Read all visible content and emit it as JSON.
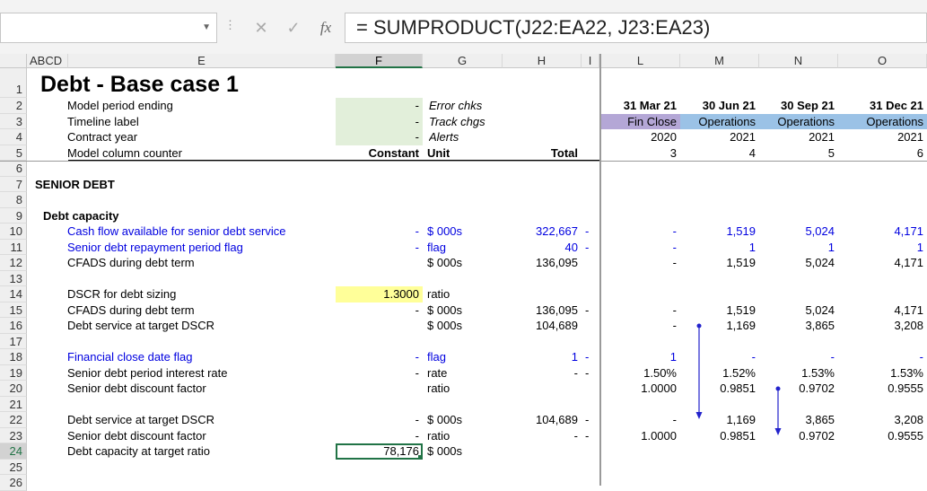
{
  "formula_bar": {
    "formula": "= SUMPRODUCT(J22:EA22, J23:EA23)",
    "cancel_icon": "✕",
    "enter_icon": "✓",
    "fx_label": "fx"
  },
  "columns": [
    "ABCD",
    "E",
    "F",
    "G",
    "H",
    "I",
    "L",
    "M",
    "N",
    "O"
  ],
  "row_numbers": [
    "1",
    "2",
    "3",
    "4",
    "5",
    "6",
    "7",
    "8",
    "9",
    "10",
    "11",
    "12",
    "13",
    "14",
    "15",
    "16",
    "17",
    "18",
    "19",
    "20",
    "21",
    "22",
    "23",
    "24",
    "25",
    "26"
  ],
  "sheet": {
    "title": "Debt - Base case 1",
    "header_rows": [
      {
        "label": "Model period ending",
        "f": "-",
        "g": "Error chks",
        "l": "31 Mar 21",
        "m": "30 Jun 21",
        "n": "30 Sep 21",
        "o": "31 Dec 21"
      },
      {
        "label": "Timeline label",
        "f": "-",
        "g": "Track chgs",
        "l": "Fin Close",
        "m": "Operations",
        "n": "Operations",
        "o": "Operations"
      },
      {
        "label": "Contract year",
        "f": "-",
        "g": "Alerts",
        "l": "2020",
        "m": "2021",
        "n": "2021",
        "o": "2021"
      },
      {
        "label": "Model column counter",
        "f": "Constant",
        "g": "Unit",
        "h": "Total",
        "l": "3",
        "m": "4",
        "n": "5",
        "o": "6"
      }
    ],
    "section": "SENIOR DEBT",
    "subsection": "Debt capacity",
    "rows": {
      "r10": {
        "label": "Cash flow available for senior debt service",
        "f": "-",
        "g": "$ 000s",
        "h": "322,667",
        "i": "-",
        "l": "-",
        "m": "1,519",
        "n": "5,024",
        "o": "4,171"
      },
      "r11": {
        "label": "Senior debt repayment period flag",
        "f": "-",
        "g": "flag",
        "h": "40",
        "i": "-",
        "l": "-",
        "m": "1",
        "n": "1",
        "o": "1"
      },
      "r12": {
        "label": "CFADS during debt term",
        "g": "$ 000s",
        "h": "136,095",
        "l": "-",
        "m": "1,519",
        "n": "5,024",
        "o": "4,171"
      },
      "r14": {
        "label": "DSCR for debt sizing",
        "f": "1.3000",
        "g": "ratio"
      },
      "r15": {
        "label": "CFADS during debt term",
        "f": "-",
        "g": "$ 000s",
        "h": "136,095",
        "i": "-",
        "l": "-",
        "m": "1,519",
        "n": "5,024",
        "o": "4,171"
      },
      "r16": {
        "label": "Debt service at target DSCR",
        "g": "$ 000s",
        "h": "104,689",
        "l": "-",
        "m": "1,169",
        "n": "3,865",
        "o": "3,208"
      },
      "r18": {
        "label": "Financial close date flag",
        "f": "-",
        "g": "flag",
        "h": "1",
        "i": "-",
        "l": "1",
        "m": "-",
        "n": "-",
        "o": "-"
      },
      "r19": {
        "label": "Senior debt period interest rate",
        "f": "-",
        "g": "rate",
        "h": "-",
        "i": "-",
        "l": "1.50%",
        "m": "1.52%",
        "n": "1.53%",
        "o": "1.53%"
      },
      "r20": {
        "label": "Senior debt discount factor",
        "g": "ratio",
        "l": "1.0000",
        "m": "0.9851",
        "n": "0.9702",
        "o": "0.9555"
      },
      "r22": {
        "label": "Debt service at target DSCR",
        "f": "-",
        "g": "$ 000s",
        "h": "104,689",
        "i": "-",
        "l": "-",
        "m": "1,169",
        "n": "3,865",
        "o": "3,208"
      },
      "r23": {
        "label": "Senior debt discount factor",
        "f": "-",
        "g": "ratio",
        "h": "-",
        "i": "-",
        "l": "1.0000",
        "m": "0.9851",
        "n": "0.9702",
        "o": "0.9555"
      },
      "r24": {
        "label": "Debt capacity at target ratio",
        "f": "78,176",
        "g": "$ 000s"
      }
    }
  },
  "colors": {
    "input_green": "#e2efda",
    "input_yellow": "#ffff99",
    "fin_close_purple": "#b4a7d6",
    "operations_blue": "#9bc2e6",
    "link_blue": "#0000e0",
    "arrow_blue": "#2222cc",
    "selection_green": "#217346"
  }
}
